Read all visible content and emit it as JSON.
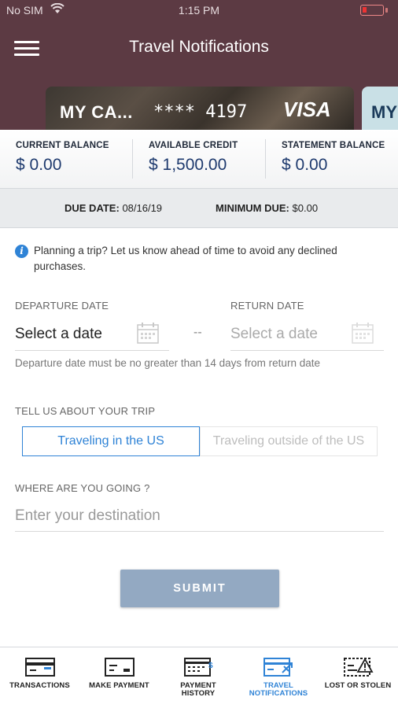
{
  "status": {
    "carrier": "No SIM",
    "time": "1:15 PM"
  },
  "header": {
    "title": "Travel Notifications"
  },
  "card": {
    "name": "MY CA...",
    "number": "**** 4197",
    "brand": "VISA",
    "next_label": "MY"
  },
  "balances": [
    {
      "label": "CURRENT BALANCE",
      "value": "$ 0.00"
    },
    {
      "label": "AVAILABLE CREDIT",
      "value": "$ 1,500.00"
    },
    {
      "label": "STATEMENT BALANCE",
      "value": "$ 0.00"
    }
  ],
  "due": {
    "date_label": "DUE DATE:",
    "date_value": "08/16/19",
    "min_label": "MINIMUM DUE:",
    "min_value": "$0.00"
  },
  "form": {
    "info_text": "Planning a trip? Let us know ahead of time to avoid any declined purchases.",
    "departure_label": "DEPARTURE DATE",
    "departure_value": "Select a date",
    "return_label": "RETURN DATE",
    "return_value": "Select a date",
    "separator": "--",
    "date_hint": "Departure date must be no greater than 14 days from return date",
    "trip_label": "TELL US ABOUT YOUR TRIP",
    "trip_options": [
      "Traveling in the US",
      "Traveling outside of the US"
    ],
    "destination_label": "WHERE ARE YOU GOING ?",
    "destination_placeholder": "Enter your destination",
    "submit_label": "SUBMIT"
  },
  "tabs": [
    {
      "label": "TRANSACTIONS",
      "icon": "transactions-icon",
      "active": false
    },
    {
      "label": "MAKE PAYMENT",
      "icon": "make-payment-icon",
      "active": false
    },
    {
      "label": "PAYMENT HISTORY",
      "icon": "payment-history-icon",
      "active": false
    },
    {
      "label": "TRAVEL NOTIFICATIONS",
      "icon": "travel-notifications-icon",
      "active": true
    },
    {
      "label": "LOST OR STOLEN",
      "icon": "lost-or-stolen-icon",
      "active": false
    }
  ],
  "colors": {
    "header": "#5c3a43",
    "accent": "#2f83d6",
    "submit": "#93a9c2",
    "balance_value": "#1e3a6e"
  }
}
